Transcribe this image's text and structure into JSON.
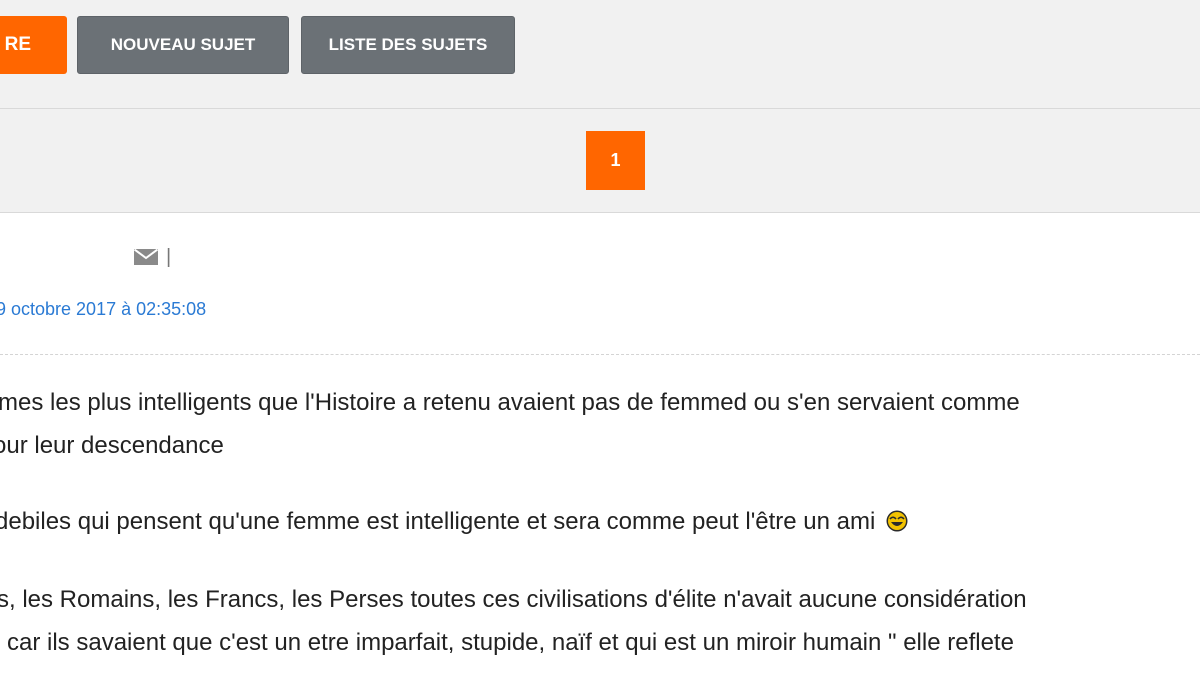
{
  "toolbar": {
    "reply_label": "RE",
    "new_topic_label": "NOUVEAU SUJET",
    "topic_list_label": "LISTE DES SUJETS"
  },
  "pagination": {
    "current_page": "1"
  },
  "post": {
    "separator": "|",
    "date": "9 octobre 2017 à 02:35:08",
    "lines": [
      "mes les plus intelligents que l'Histoire a retenu avaient pas de femmed ou s'en servaient comme",
      "our leur descendance",
      "debiles qui pensent qu'une femme est intelligente et sera comme peut l'être un ami",
      "s, les Romains, les Francs, les Perses toutes ces civilisations d'élite n'avait aucune considération",
      "car ils savaient que c'est un etre imparfait, stupide, naïf et qui est un miroir humain \" elle reflete"
    ],
    "emoji_icon": "laughing-emoji-icon"
  },
  "colors": {
    "accent_orange": "#ff6600",
    "button_grey": "#6b7176",
    "date_link": "#2a7ad4",
    "toolbar_bg": "#f1f1f1"
  }
}
